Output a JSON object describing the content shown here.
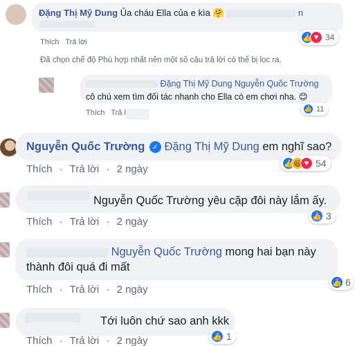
{
  "c1": {
    "author": "Đặng Thị Mỹ Dung",
    "text": "Ủa cháu Ella của e kìa",
    "emoji": "🤗",
    "tail": "n",
    "actions": [
      "Thích",
      "Trả lời"
    ],
    "reaction_count": "34"
  },
  "filter_notice": "Đã chọn chế độ Phù hợp nhất nên một số câu trả lời có thể bị lọc ra.",
  "c2": {
    "tags": "Đặng Thị Mỹ Dung Nguyễn Quốc Trường",
    "text": "cô chú xem tìm đối tác nhanh cho Ella có em chơi nha.",
    "emoji": "😊",
    "actions": [
      "Thích",
      "Trả lời"
    ],
    "reaction_count": "11"
  },
  "c3": {
    "author": "Nguyễn Quốc Trường",
    "tag": "Đặng Thị Mỹ Dung",
    "text": "em nghĩ sao?",
    "actions": [
      "Thích",
      "Trả lời",
      "2 ngày"
    ],
    "reaction_count": "54"
  },
  "c4": {
    "text": "Nguyễn Quốc Trường yêu cặp đôi này lắm ấy.",
    "actions": [
      "Thích",
      "Trả lời",
      "2 ngày"
    ],
    "reaction_count": "3"
  },
  "c5": {
    "tag": "Nguyễn Quốc Trường",
    "text1": "mong hai bạn này",
    "text2": "thành đôi quá đi mất",
    "actions": [
      "Thích",
      "Trả lời",
      "2 ngày"
    ],
    "reaction_count": "6"
  },
  "c6": {
    "text": "Tới luôn chứ sao anh kkk",
    "actions": [
      "Thích",
      "Trả lời",
      "2 ngày"
    ],
    "reaction_count": "1"
  },
  "colors": {
    "link": "#385898",
    "bubble": "#f0f2f5",
    "like": "#1877f2",
    "love": "#f02849",
    "haha": "#f7b928"
  }
}
